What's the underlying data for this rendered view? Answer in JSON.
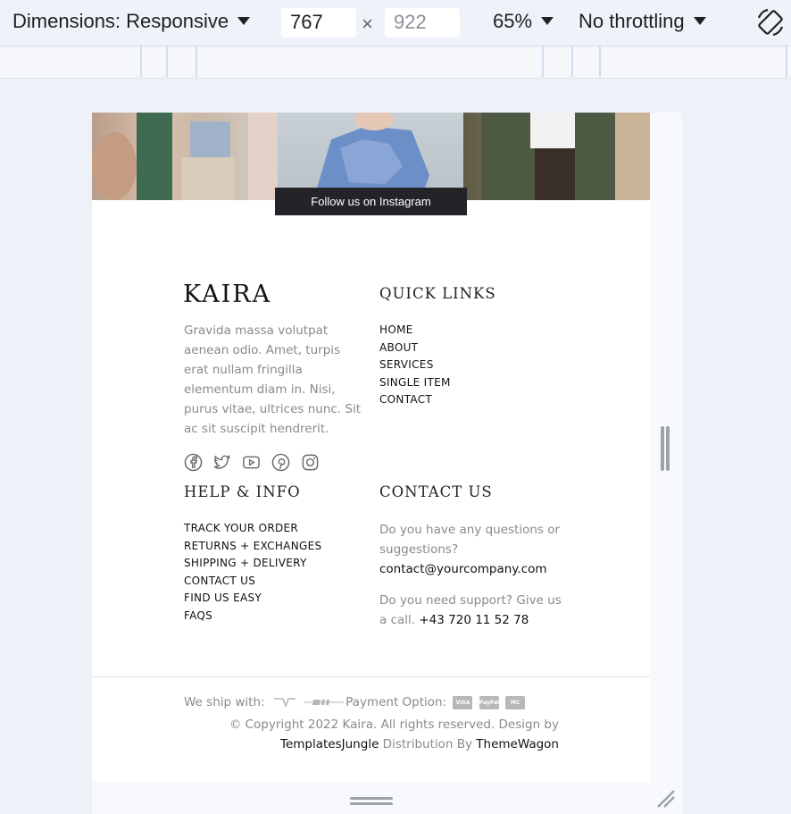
{
  "devtools": {
    "dimensions_label": "Dimensions: Responsive",
    "width": "767",
    "height": "922",
    "times": "×",
    "zoom": "65%",
    "throttling": "No throttling"
  },
  "instagram": {
    "follow_label": "Follow us on Instagram"
  },
  "footer": {
    "logo": "KAIRA",
    "about": "Gravida massa volutpat aenean odio. Amet, turpis erat nullam fringilla elementum diam in. Nisi, purus vitae, ultrices nunc. Sit ac sit suscipit hendrerit.",
    "social_icons": [
      "facebook-icon",
      "twitter-icon",
      "youtube-icon",
      "pinterest-icon",
      "instagram-icon"
    ],
    "quick_links": {
      "title": "QUICK LINKS",
      "items": [
        "HOME",
        "ABOUT",
        "SERVICES",
        "SINGLE ITEM",
        "CONTACT"
      ]
    },
    "help_info": {
      "title": "HELP & INFO",
      "items": [
        "TRACK YOUR ORDER",
        "RETURNS + EXCHANGES",
        "SHIPPING + DELIVERY",
        "CONTACT US",
        "FIND US EASY",
        "FAQS"
      ]
    },
    "contact": {
      "title": "CONTACT US",
      "question": "Do you have any questions or suggestions?",
      "email": "contact@yourcompany.com",
      "support": "Do you need support? Give us a call.",
      "phone": "+43 720 11 52 78"
    },
    "bottom": {
      "ship_label": "We ship with:",
      "payment_label": "Payment Option:",
      "payment_cards": [
        "VISA",
        "PayPal",
        "MC"
      ],
      "copyright": "© Copyright 2022 Kaira. All rights reserved. Design by",
      "design_link": "TemplatesJungle",
      "distribution": "Distribution By",
      "distribution_link": "ThemeWagon"
    }
  }
}
